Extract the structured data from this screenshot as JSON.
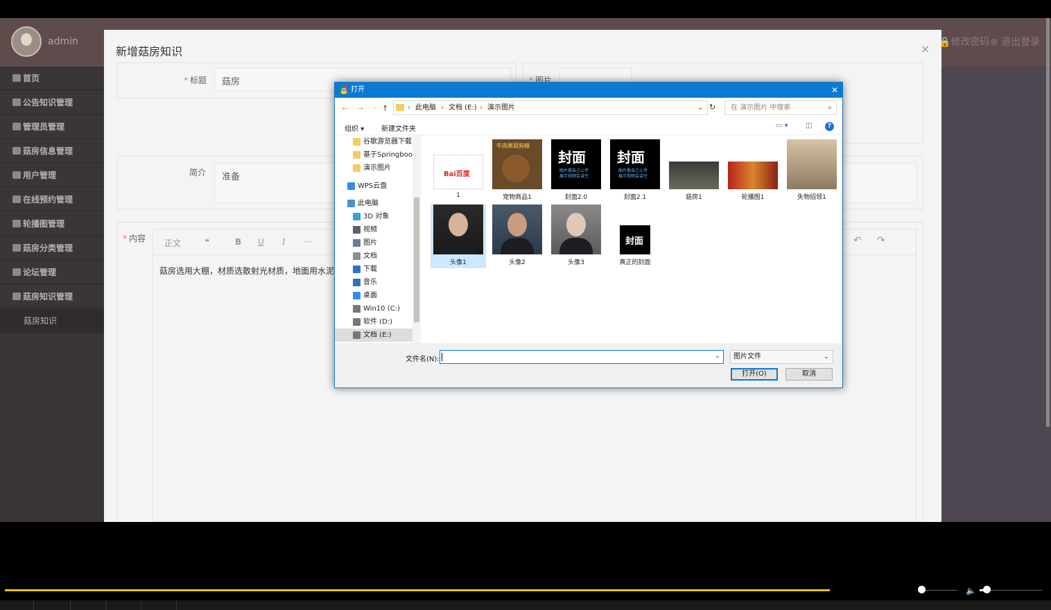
{
  "app": {
    "username": "admin",
    "change_password": "修改密码",
    "logout": "退出登录"
  },
  "sidebar": {
    "items": [
      {
        "label": "首页"
      },
      {
        "label": "公告知识管理"
      },
      {
        "label": "管理员管理"
      },
      {
        "label": "菇房信息管理"
      },
      {
        "label": "用户管理"
      },
      {
        "label": "在线预约管理"
      },
      {
        "label": "轮播图管理"
      },
      {
        "label": "菇房分类管理"
      },
      {
        "label": "论坛管理"
      },
      {
        "label": "菇房知识管理"
      }
    ],
    "sub_item": "菇房知识"
  },
  "modal": {
    "title": "新增菇房知识",
    "close": "×",
    "title_label": "标题",
    "title_value": "菇房",
    "image_label": "图片",
    "summary_label": "简介",
    "summary_value": "准备",
    "content_label": "内容",
    "toolbar": {
      "paragraph": "正文",
      "quote": "❝",
      "bold": "B",
      "underline": "U",
      "italic": "I",
      "more": "···",
      "undo": "↶",
      "redo": "↷"
    },
    "content_value": "菇房选用大棚，材质选散射光材质，地面用水泥"
  },
  "dialog": {
    "title": "打开",
    "close": "✕",
    "breadcrumb": [
      "此电脑",
      "文档 (E:)",
      "演示图片"
    ],
    "search_placeholder": "在 演示图片 中搜索",
    "organize": "组织 ▾",
    "new_folder": "新建文件夹",
    "nav": [
      {
        "label": "谷歌游览器下载",
        "color": "#f3cd5f"
      },
      {
        "label": "基于Springboo",
        "color": "#f3cd5f"
      },
      {
        "label": "演示图片",
        "color": "#f3cd5f"
      },
      {
        "label": "WPS云盘",
        "color": "#2f8fe8"
      },
      {
        "label": "此电脑",
        "color": "#4a90d9"
      },
      {
        "label": "3D 对象",
        "color": "#39a3d8"
      },
      {
        "label": "视频",
        "color": "#5a6272"
      },
      {
        "label": "图片",
        "color": "#6a7d94"
      },
      {
        "label": "文档",
        "color": "#8a8f96"
      },
      {
        "label": "下载",
        "color": "#2f74c0"
      },
      {
        "label": "音乐",
        "color": "#2f74c0"
      },
      {
        "label": "桌面",
        "color": "#2f8fe8"
      },
      {
        "label": "Win10 (C:)",
        "color": "#777"
      },
      {
        "label": "软件 (D:)",
        "color": "#777"
      },
      {
        "label": "文档 (E:)",
        "color": "#777"
      }
    ],
    "files": [
      {
        "name": "1"
      },
      {
        "name": "宠物商品1"
      },
      {
        "name": "封面2.0"
      },
      {
        "name": "封面2.1"
      },
      {
        "name": "菇房1"
      },
      {
        "name": "轮播图1"
      },
      {
        "name": "失物招领1"
      },
      {
        "name": "头像1"
      },
      {
        "name": "头像2"
      },
      {
        "name": "头像3"
      },
      {
        "name": "真正的封面"
      }
    ],
    "cover_text": "封面",
    "cover_sub": "图片需自己上传\n展示视频会讲空",
    "baidu_text": "Bai百度",
    "pet_text": "牛肉果蔬狗粮",
    "filename_label": "文件名(N):",
    "filetype": "图片文件",
    "open_button": "打开(O)",
    "cancel_button": "取消"
  },
  "player": {
    "progress": 0.9,
    "volume": 0.11
  }
}
